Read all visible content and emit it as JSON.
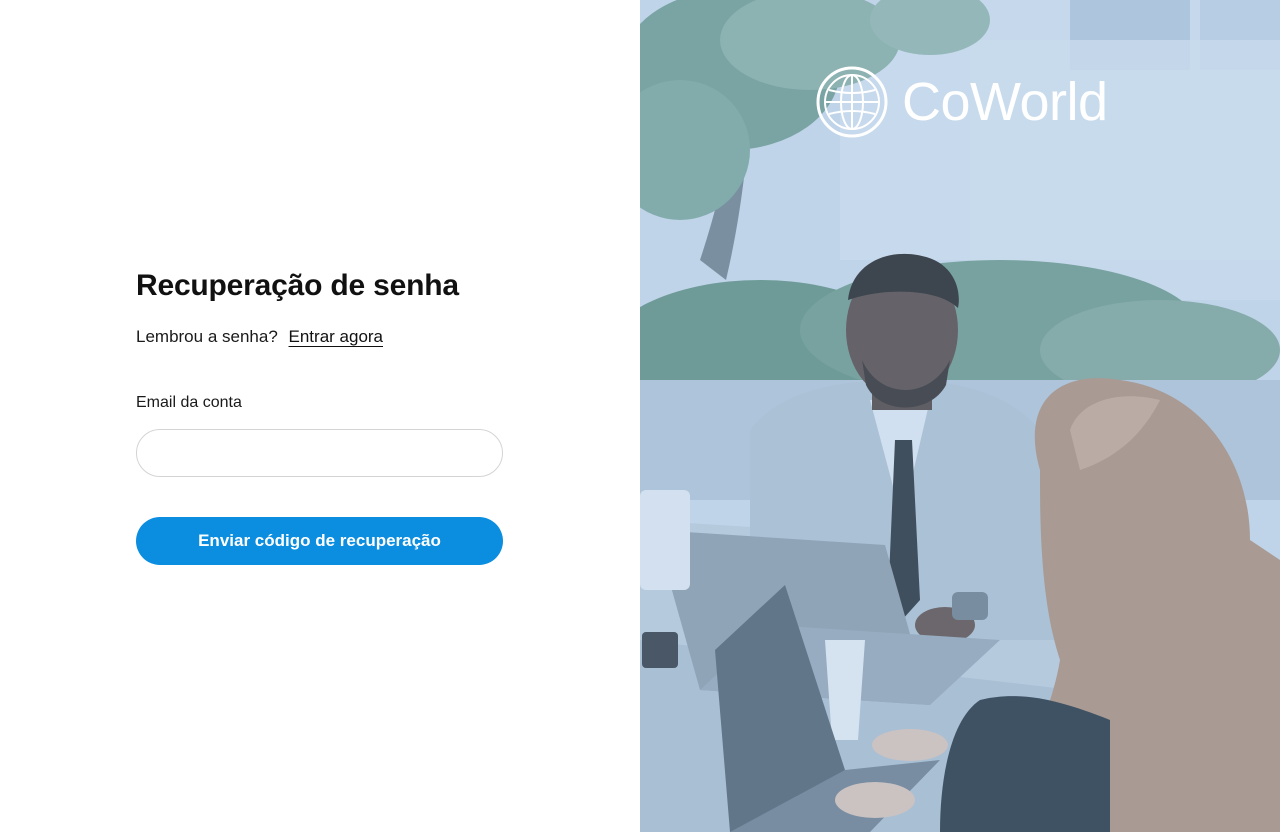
{
  "form": {
    "title": "Recuperação de senha",
    "remember_prompt": "Lembrou a senha?",
    "login_link": "Entrar agora",
    "email_label": "Email da conta",
    "email_value": "",
    "email_placeholder": "",
    "submit_label": "Enviar código de recuperação"
  },
  "brand": {
    "name": "CoWorld",
    "logo_icon": "globe-icon"
  },
  "colors": {
    "primary_button": "#0b8de0",
    "input_border": "#d4d4d4",
    "image_tint": "#96bee6"
  }
}
